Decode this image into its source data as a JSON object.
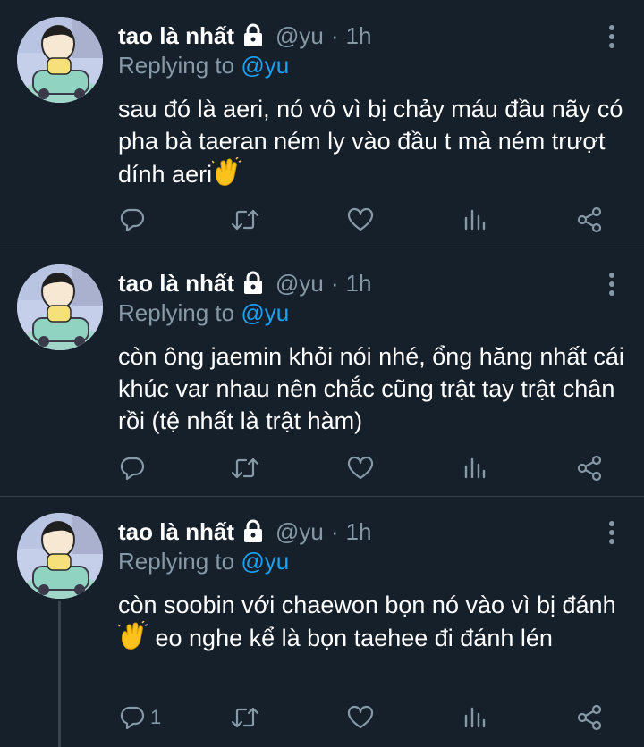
{
  "tweets": [
    {
      "display_name": "tao là nhất",
      "handle": "@yu",
      "separator": "·",
      "time": "1h",
      "replying_prefix": "Replying to",
      "replying_handle": "@yu",
      "text_before_emoji": "sau đó là aeri, nó vô vì bị chảy máu đầu nãy có pha bà taeran ném ly vào đầu t mà ném trượt dính aeri",
      "text_after_emoji": "",
      "emoji": "waving-hands",
      "reply_count": ""
    },
    {
      "display_name": "tao là nhất",
      "handle": "@yu",
      "separator": "·",
      "time": "1h",
      "replying_prefix": "Replying to",
      "replying_handle": "@yu",
      "text_before_emoji": "còn ông jaemin khỏi nói nhé, ổng hăng nhất cái khúc var nhau nên chắc cũng trật tay trật chân rồi (tệ nhất là trật hàm)",
      "text_after_emoji": "",
      "emoji": "",
      "reply_count": ""
    },
    {
      "display_name": "tao là nhất",
      "handle": "@yu",
      "separator": "·",
      "time": "1h",
      "replying_prefix": "Replying to",
      "replying_handle": "@yu",
      "text_before_emoji": "còn soobin với chaewon bọn nó vào vì bị đánh",
      "text_after_emoji": " eo nghe kể là bọn taehee đi đánh lén",
      "emoji": "waving-hands",
      "reply_count": "1"
    }
  ],
  "colors": {
    "background": "#15202b",
    "divider": "#38444d",
    "secondary_text": "#8899a6",
    "accent": "#1da1f2",
    "primary_text": "#ffffff"
  },
  "icons": [
    "lock-icon",
    "more-icon",
    "reply-icon",
    "retweet-icon",
    "like-icon",
    "analytics-icon",
    "share-icon",
    "waving-hands-emoji"
  ]
}
